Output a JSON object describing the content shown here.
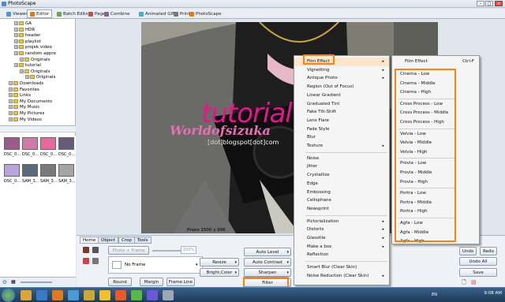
{
  "window": {
    "title": "PhotoScape"
  },
  "tabs": [
    {
      "label": "Viewer",
      "color": "#5a8fd0"
    },
    {
      "label": "Editor",
      "color": "#e07a1f"
    },
    {
      "label": "Batch Editor",
      "color": "#6aa84f"
    },
    {
      "label": "Page",
      "color": "#c0504d"
    },
    {
      "label": "Combine",
      "color": "#8064a2"
    },
    {
      "label": "Animated GIF",
      "color": "#4bacc6"
    },
    {
      "label": "Print",
      "color": "#777777"
    },
    {
      "label": "PhotoScape",
      "color": "#e07a1f"
    }
  ],
  "tree": [
    {
      "label": "GA",
      "level": 2
    },
    {
      "label": "HDR",
      "level": 2
    },
    {
      "label": "header",
      "level": 2
    },
    {
      "label": "playlist",
      "level": 2
    },
    {
      "label": "projek video",
      "level": 2
    },
    {
      "label": "random appre",
      "level": 2
    },
    {
      "label": "Originals",
      "level": 3
    },
    {
      "label": "tutorial",
      "level": 2
    },
    {
      "label": "Originals",
      "level": 3
    },
    {
      "label": "Originals",
      "level": 4
    },
    {
      "label": "Downloads",
      "level": 1
    },
    {
      "label": "Favorites",
      "level": 1
    },
    {
      "label": "Links",
      "level": 1
    },
    {
      "label": "My Documents",
      "level": 1
    },
    {
      "label": "My Music",
      "level": 1
    },
    {
      "label": "My Pictures",
      "level": 1
    },
    {
      "label": "My Videos",
      "level": 1
    }
  ],
  "thumbnails": [
    {
      "caption": "DSC_0...",
      "color": "#9a5a8a"
    },
    {
      "caption": "DSC_0...",
      "color": "#d07aa8"
    },
    {
      "caption": "DSC_0...",
      "color": "#e46aa0"
    },
    {
      "caption": "DSC_0...",
      "color": "#6a5a7a"
    },
    {
      "caption": "DSC_0...",
      "color": "#b8a4d8"
    },
    {
      "caption": "SAM_3...",
      "color": "#5a6a7a"
    },
    {
      "caption": "SAM_3...",
      "color": "#7a7a7a"
    },
    {
      "caption": "SAM_3...",
      "color": "#a4a4a4"
    }
  ],
  "watermark": {
    "line1": "tutorial",
    "line2": "Worldofsizuka",
    "line3": "[dot]blogspot[dot]com"
  },
  "photo_info": "Photo 1500 x 996",
  "bottom_tabs": [
    "Home",
    "Object",
    "Crop",
    "Tools"
  ],
  "frame": {
    "photo_frame": "Photo + Frame",
    "zoom": "100%",
    "selected": "No Frame"
  },
  "bottom_buttons": {
    "round": "Round",
    "margin": "Margin",
    "frame_line": "Frame Line",
    "resize": "Resize",
    "bright_color": "Bright,Color",
    "auto_level": "Auto Level",
    "auto_contrast": "Auto Contrast",
    "sharpen": "Sharpen",
    "filter": "Filter",
    "undo": "Undo",
    "redo": "Redo",
    "undo_all": "Undo All",
    "save": "Save"
  },
  "filter_menu": [
    {
      "label": "Film Effect",
      "sub": true
    },
    {
      "label": "Vignetting",
      "sub": true
    },
    {
      "label": "Antique Photo",
      "sub": true
    },
    {
      "label": "Region (Out of Focus)",
      "sub": false
    },
    {
      "label": "Linear Gradient",
      "sub": false
    },
    {
      "label": "Graduated Tint",
      "sub": false
    },
    {
      "label": "Fake Tilt-Shift",
      "sub": false
    },
    {
      "label": "Lens Flare",
      "sub": false
    },
    {
      "label": "Fade Style",
      "sub": false
    },
    {
      "label": "Blur",
      "sub": false
    },
    {
      "label": "Texture",
      "sub": true
    },
    {
      "label": "Noise",
      "sub": false
    },
    {
      "label": "Jitter",
      "sub": false
    },
    {
      "label": "Crystallize",
      "sub": false
    },
    {
      "label": "Edge",
      "sub": false
    },
    {
      "label": "Embossing",
      "sub": false
    },
    {
      "label": "Cellophane",
      "sub": false
    },
    {
      "label": "Newsprint",
      "sub": false
    },
    {
      "label": "Pictorialization",
      "sub": true
    },
    {
      "label": "Distorts",
      "sub": true
    },
    {
      "label": "Glasstile",
      "sub": true
    },
    {
      "label": "Make a box",
      "sub": true
    },
    {
      "label": "Reflection",
      "sub": false
    },
    {
      "label": "Smart Blur (Clear Skin)",
      "sub": false
    },
    {
      "label": "Noise Reduction (Clear Skin)",
      "sub": true
    }
  ],
  "film_menu": {
    "header": "Film Effect",
    "shortcut": "Ctrl-F",
    "groups": [
      [
        "Cinema - Low",
        "Cinema - Middle",
        "Cinema - High"
      ],
      [
        "Cross Process - Low",
        "Cross Process - Middle",
        "Cross Process - High"
      ],
      [
        "Velvia - Low",
        "Velvia - Middle",
        "Velvia - High"
      ],
      [
        "Provia - Low",
        "Provia - Middle",
        "Provia - High"
      ],
      [
        "Portra - Low",
        "Portra - Middle",
        "Portra - High"
      ],
      [
        "Agfa - Low",
        "Agfa - Middle",
        "Agfa - High"
      ]
    ]
  },
  "taskbar": {
    "lang": "EN",
    "time": "9:08 AM"
  },
  "colors": {
    "highlight": "#ff7f0f",
    "watermark": "#e2188a"
  }
}
